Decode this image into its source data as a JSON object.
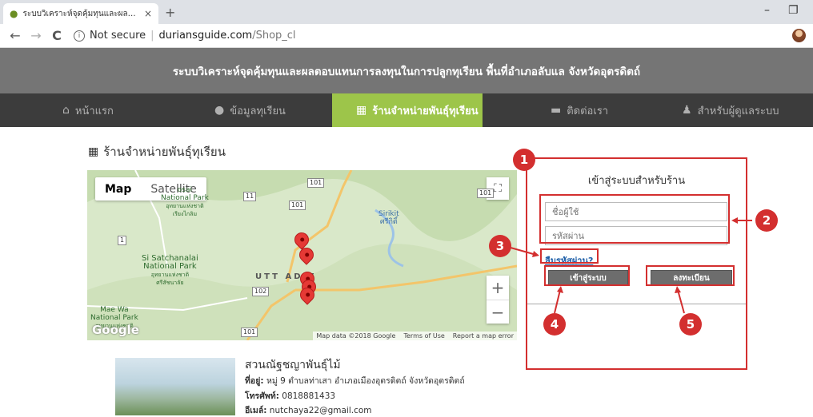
{
  "browser": {
    "tab_title": "ระบบวิเคราะห์จุดคุ้มทุนและผลตอบแทน",
    "tab_close": "×",
    "new_tab": "+",
    "minimize": "–",
    "restore": "❐",
    "back": "←",
    "forward": "→",
    "reload": "C",
    "security_label": "Not secure",
    "url_host": "duriansguide.com",
    "url_path": "/Shop_cl",
    "info_glyph": "i"
  },
  "header": {
    "title": "ระบบวิเคราะห์จุดคุ้มทุนและผลตอบแทนการลงทุนในการปลูกทุเรียน พื้นที่อำเภอลับแล จังหวัดอุตรดิตถ์"
  },
  "nav": [
    {
      "label": "หน้าแรก",
      "icon": "home-icon",
      "glyph": "🏠",
      "active": false
    },
    {
      "label": "ข้อมูลทุเรียน",
      "icon": "durian-icon",
      "glyph": "●",
      "active": false
    },
    {
      "label": "ร้านจำหน่ายพันธุ์ทุเรียน",
      "icon": "store-icon",
      "glyph": "▦",
      "active": true
    },
    {
      "label": "ติดต่อเรา",
      "icon": "chat-icon",
      "glyph": "▬",
      "active": false
    },
    {
      "label": "สำหรับผู้ดูแลระบบ",
      "icon": "user-icon",
      "glyph": "♟",
      "active": false
    }
  ],
  "colors": {
    "accent": "#9dc54a",
    "annotation": "#d32f2f",
    "header_bg": "#757575",
    "nav_bg": "#3c3c3c"
  },
  "section": {
    "icon": "store-icon",
    "glyph": "▦",
    "title": "ร้านจำหน่ายพันธุ์ทุเรียน"
  },
  "map": {
    "tab_map": "Map",
    "tab_satellite": "Satellite",
    "fullscreen": "⛶",
    "zoom_in": "+",
    "zoom_out": "−",
    "labels": {
      "park1_line1": "osai",
      "park1_line2": "National Park",
      "park1_line3": "อุทยานแห่งชาติ",
      "park1_line4": "เรียงไกลิม",
      "park2_line1": "Si Satchanalai",
      "park2_line2": "National Park",
      "park2_line3": "อุทยานแห่งชาติ",
      "park2_line4": "ศรีสัชนาลัย",
      "park3_line1": "Mae Wa",
      "park3_line2": "National Park",
      "park3_line3": "อุทยานแห่งชาติ",
      "sirikit_line1": "Sirikit",
      "sirikit_line2": "ศรีกิติ์",
      "city": "UTT   ADIT"
    },
    "roads": [
      "101",
      "11",
      "101",
      "101",
      "1",
      "102",
      "101"
    ],
    "google": "Google",
    "attribution": [
      "Map data ©2018 Google",
      "Terms of Use",
      "Report a map error"
    ]
  },
  "shop": {
    "name": "สวนณัฐชญาพันธุ์ไม้",
    "address_label": "ที่อยู่:",
    "address": "หมู่ 9 ตำบลท่าเสา อำเภอเมืองอุตรดิตถ์ จังหวัดอุตรดิตถ์",
    "phone_label": "โทรศัพท์:",
    "phone": "0818881433",
    "email_label": "อีเมล์:",
    "email": "nutchaya22@gmail.com"
  },
  "login": {
    "title": "เข้าสู่ระบบสำหรับร้าน",
    "username_placeholder": "ชื่อผู้ใช้",
    "password_placeholder": "รหัสผ่าน",
    "forgot": "ลืมรหัสผ่าน?",
    "login_button": "เข้าสู่ระบบ",
    "register_button": "ลงทะเบียน"
  },
  "annotations": [
    "1",
    "2",
    "3",
    "4",
    "5"
  ]
}
